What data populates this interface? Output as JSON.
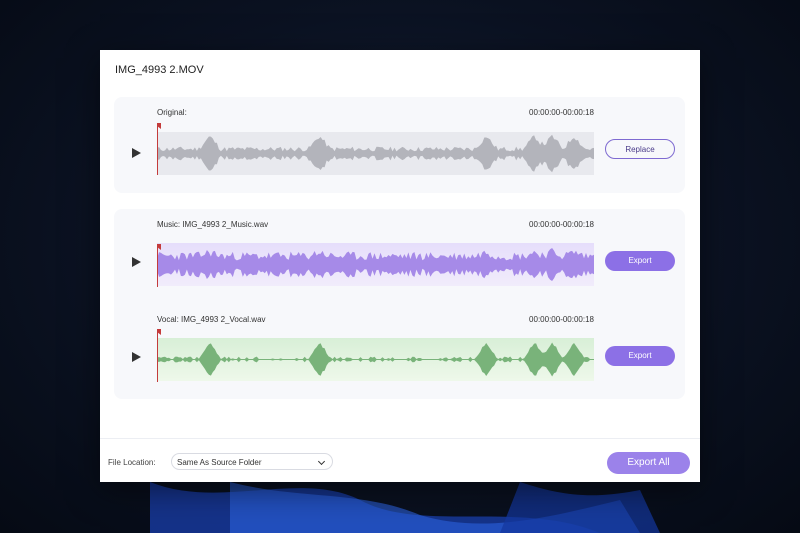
{
  "window": {
    "title": "IMG_4993 2.MOV"
  },
  "tracks": [
    {
      "label": "Original:",
      "time": "00:00:00-00:00:18",
      "button": "Replace",
      "wave_color": "#b3b4bb"
    },
    {
      "label": "Music: IMG_4993 2_Music.wav",
      "time": "00:00:00-00:00:18",
      "button": "Export",
      "wave_color": "#a68ae8"
    },
    {
      "label": "Vocal: IMG_4993 2_Vocal.wav",
      "time": "00:00:00-00:00:18",
      "button": "Export",
      "wave_color": "#79b37a"
    }
  ],
  "footer": {
    "location_label": "File Location:",
    "location_value": "Same As Source Folder",
    "export_all": "Export All"
  },
  "colors": {
    "accent": "#8c70e6",
    "playhead": "#c43b3b"
  }
}
